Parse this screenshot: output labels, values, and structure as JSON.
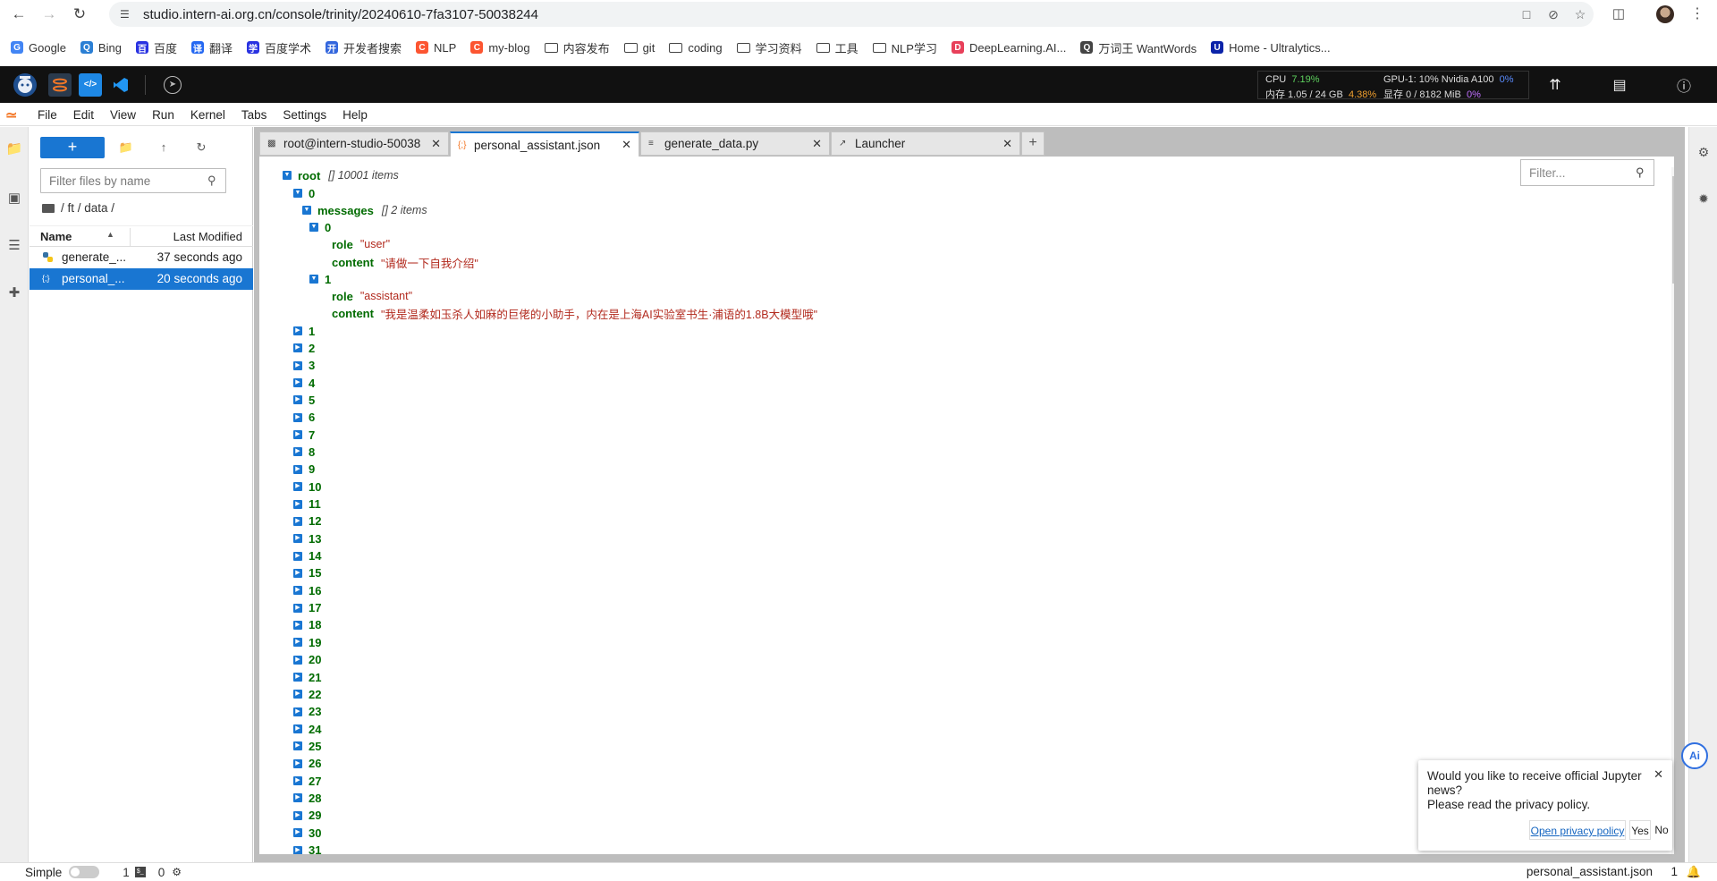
{
  "browser": {
    "url": "studio.intern-ai.org.cn/console/trinity/20240610-7fa3107-50038244",
    "bookmarks": [
      {
        "label": "Google",
        "color": "#4285f4",
        "glyph": "G"
      },
      {
        "label": "Bing",
        "color": "#2b7fd4",
        "glyph": "Q"
      },
      {
        "label": "百度",
        "color": "#2932e1",
        "glyph": "百"
      },
      {
        "label": "翻译",
        "color": "#2468f2",
        "glyph": "译"
      },
      {
        "label": "百度学术",
        "color": "#2932e1",
        "glyph": "学"
      },
      {
        "label": "开发者搜索",
        "color": "#3366dd",
        "glyph": "开"
      },
      {
        "label": "NLP",
        "color": "#fc5531",
        "glyph": "C"
      },
      {
        "label": "my-blog",
        "color": "#fc5531",
        "glyph": "C"
      },
      {
        "label": "内容发布",
        "folder": true
      },
      {
        "label": "git",
        "folder": true
      },
      {
        "label": "coding",
        "folder": true
      },
      {
        "label": "学习资料",
        "folder": true
      },
      {
        "label": "工具",
        "folder": true
      },
      {
        "label": "NLP学习",
        "folder": true
      },
      {
        "label": "DeepLearning.AI...",
        "color": "#e8405a",
        "glyph": "D"
      },
      {
        "label": "万词王 WantWords",
        "color": "#444444",
        "glyph": "Q"
      },
      {
        "label": "Home - Ultralytics...",
        "color": "#0b23a9",
        "glyph": "U"
      }
    ]
  },
  "studio": {
    "cpu_label": "CPU",
    "cpu_value": "7.19%",
    "mem_label": "内存 1.05 / 24 GB",
    "mem_value": "4.38%",
    "gpu_label": "GPU-1: 10% Nvidia A100",
    "gpu_value": "0%",
    "vram_label": "显存 0 / 8182 MiB",
    "vram_value": "0%"
  },
  "menubar": [
    "File",
    "Edit",
    "View",
    "Run",
    "Kernel",
    "Tabs",
    "Settings",
    "Help"
  ],
  "file_browser": {
    "new_button": "+",
    "filter_placeholder": "Filter files by name",
    "breadcrumb": "/ ft / data /",
    "col_name": "Name",
    "col_modified": "Last Modified",
    "files": [
      {
        "name": "generate_...",
        "modified": "37 seconds ago",
        "type": "python"
      },
      {
        "name": "personal_...",
        "modified": "20 seconds ago",
        "type": "json",
        "selected": true
      }
    ]
  },
  "tabs": [
    {
      "label": "root@intern-studio-50038",
      "icon": "terminal-icon"
    },
    {
      "label": "personal_assistant.json",
      "icon": "json-file-icon",
      "active": true
    },
    {
      "label": "generate_data.py",
      "icon": "text-file-icon"
    },
    {
      "label": "Launcher",
      "icon": "launcher-icon"
    }
  ],
  "json_viewer": {
    "filter_placeholder": "Filter...",
    "root_key": "root",
    "root_meta": "[] 10001 items",
    "item0_key": "0",
    "messages_key": "messages",
    "messages_meta": "[] 2 items",
    "msg0_index": "0",
    "msg0_role_key": "role",
    "msg0_role_value": "\"user\"",
    "msg0_content_key": "content",
    "msg0_content_value": "\"请做一下自我介绍\"",
    "msg1_index": "1",
    "msg1_role_key": "role",
    "msg1_role_value": "\"assistant\"",
    "msg1_content_key": "content",
    "msg1_content_value": "\"我是温柔如玉杀人如麻的巨佬的小助手，内在是上海AI实验室书生·浦语的1.8B大模型哦\"",
    "collapsed_items": [
      "1",
      "2",
      "3",
      "4",
      "5",
      "6",
      "7",
      "8",
      "9",
      "10",
      "11",
      "12",
      "13",
      "14",
      "15",
      "16",
      "17",
      "18",
      "19",
      "20",
      "21",
      "22",
      "23",
      "24",
      "25",
      "26",
      "27",
      "28",
      "29",
      "30",
      "31"
    ]
  },
  "notification": {
    "message_line1": "Would you like to receive official Jupyter news?",
    "message_line2": "Please read the privacy policy.",
    "policy_link": "Open privacy policy",
    "yes": "Yes",
    "no": "No"
  },
  "ai_button": "Ai",
  "status_bar": {
    "mode": "Simple",
    "terminals": "1",
    "kernels": "0",
    "current_file": "personal_assistant.json",
    "line": "1"
  }
}
